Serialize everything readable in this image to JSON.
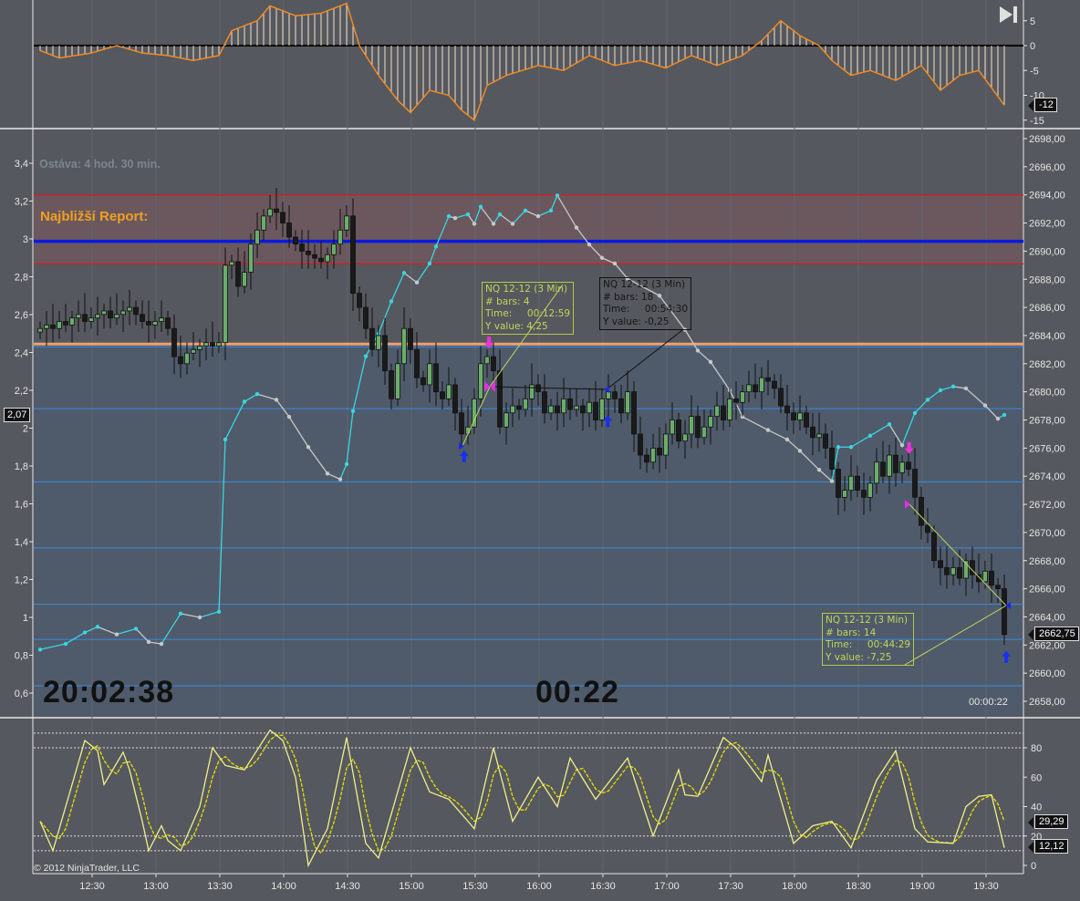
{
  "colors": {
    "bg": "#55585e",
    "up": "#6aad6a",
    "down": "#1a1a1a",
    "osc": "#f08a24",
    "cyan": "#3ad6e0",
    "gray": "#c8c8c8",
    "stochK": "#f0f08a",
    "stochD": "#e8e000",
    "red": "#c0262a",
    "blue": "#0a1ae0",
    "orange": "#f0a070",
    "hline": "#3a8ce0"
  },
  "labels": {
    "remaining": "Ostáva: 4 hod. 30 min.",
    "next_report": "Najbližší Report:",
    "clock": "20:02:38",
    "countdown": "00:22",
    "bar_timer": "00:00:22",
    "copyright": "© 2012 NinjaTrader, LLC"
  },
  "badges": {
    "osc": "-12",
    "price": "2662,75",
    "left": "2,07",
    "stoch_d": "29,29",
    "stoch_k": "12,12"
  },
  "tooltips": [
    {
      "lines": [
        "NQ 12-12 (3 Min)",
        "# bars: 4",
        "Time:     00:12:59",
        "Y value: 4,25"
      ]
    },
    {
      "lines": [
        "NQ 12-12 (3 Min)",
        "# bars: 18",
        "Time:     00:54:30",
        "Y value: -0,25"
      ]
    },
    {
      "lines": [
        "NQ 12-12 (3 Min)",
        "# bars: 14",
        "Time:     00:44:29",
        "Y value: -7,25"
      ]
    }
  ],
  "chart_data": [
    {
      "type": "bar",
      "name": "oscillator-histogram",
      "ylim": [
        -16,
        8
      ],
      "yticks": [
        "5",
        "0",
        "-5",
        "-10",
        "-15"
      ],
      "ytick_values": [
        5,
        0,
        -5,
        -10,
        -15
      ],
      "keyframes": [
        [
          0,
          -1
        ],
        [
          3,
          -2.5
        ],
        [
          8,
          -1.5
        ],
        [
          12,
          0
        ],
        [
          16,
          -1.5
        ],
        [
          20,
          -2
        ],
        [
          24,
          -3
        ],
        [
          28,
          -2
        ],
        [
          30,
          3
        ],
        [
          34,
          5
        ],
        [
          36,
          8
        ],
        [
          40,
          6
        ],
        [
          44,
          6.5
        ],
        [
          48,
          8.5
        ],
        [
          50,
          0
        ],
        [
          53,
          -6
        ],
        [
          56,
          -11
        ],
        [
          58,
          -13.5
        ],
        [
          61,
          -9
        ],
        [
          64,
          -10
        ],
        [
          66,
          -13
        ],
        [
          68,
          -15
        ],
        [
          70,
          -8
        ],
        [
          73,
          -6
        ],
        [
          78,
          -4
        ],
        [
          82,
          -5
        ],
        [
          86,
          -2
        ],
        [
          90,
          -4
        ],
        [
          94,
          -3
        ],
        [
          98,
          -4.5
        ],
        [
          102,
          -2
        ],
        [
          106,
          -4
        ],
        [
          110,
          -2
        ],
        [
          113,
          1
        ],
        [
          116,
          5
        ],
        [
          119,
          2
        ],
        [
          122,
          0
        ],
        [
          124,
          -3
        ],
        [
          127,
          -6
        ],
        [
          130,
          -5
        ],
        [
          134,
          -7
        ],
        [
          138,
          -4
        ],
        [
          141,
          -9
        ],
        [
          144,
          -6
        ],
        [
          147,
          -5
        ],
        [
          149,
          -8.5
        ],
        [
          151,
          -12
        ]
      ]
    },
    {
      "type": "candlestick",
      "name": "NQ 12-12 (3 Min)",
      "ylim": [
        2657,
        2699
      ],
      "yticks": [
        "2698,00",
        "2696,00",
        "2694,00",
        "2692,00",
        "2690,00",
        "2688,00",
        "2686,00",
        "2684,00",
        "2682,00",
        "2680,00",
        "2678,00",
        "2676,00",
        "2674,00",
        "2672,00",
        "2670,00",
        "2668,00",
        "2666,00",
        "2664,00",
        "2662,00",
        "2660,00",
        "2658,00"
      ],
      "ytick_values": [
        2698,
        2696,
        2694,
        2692,
        2690,
        2688,
        2686,
        2684,
        2682,
        2680,
        2678,
        2676,
        2674,
        2672,
        2670,
        2668,
        2666,
        2664,
        2662,
        2660,
        2658
      ],
      "closes": [
        2684.5,
        2684.75,
        2684.5,
        2685,
        2684.75,
        2685.25,
        2685.5,
        2685,
        2685.25,
        2685.5,
        2685.75,
        2685.25,
        2685.5,
        2685.75,
        2686,
        2685.5,
        2685,
        2684.75,
        2685,
        2685.25,
        2684.5,
        2682.5,
        2682,
        2682.75,
        2683,
        2683.25,
        2683.5,
        2683.25,
        2683.5,
        2689,
        2689.25,
        2687.5,
        2688.5,
        2690.5,
        2691.5,
        2692.5,
        2693,
        2692.75,
        2692,
        2691,
        2690.5,
        2690,
        2689.75,
        2689.5,
        2689.25,
        2689.75,
        2690.5,
        2691.5,
        2692.5,
        2687,
        2686,
        2684.5,
        2683,
        2684,
        2681.5,
        2679.5,
        2682,
        2684.5,
        2683,
        2681,
        2680.5,
        2682,
        2680,
        2679.5,
        2680.5,
        2678.5,
        2677,
        2677.5,
        2679.5,
        2682,
        2682.5,
        2681.5,
        2677.5,
        2678.5,
        2679,
        2678.75,
        2679.5,
        2680.5,
        2680,
        2678.5,
        2679,
        2678.5,
        2679.5,
        2678.75,
        2679,
        2678.5,
        2679.25,
        2678,
        2679.5,
        2680,
        2679.5,
        2678.5,
        2680,
        2677,
        2675.5,
        2675,
        2676,
        2675.5,
        2677,
        2678,
        2676.5,
        2677,
        2678.25,
        2676.75,
        2677.5,
        2678.25,
        2679,
        2678,
        2679.5,
        2679.25,
        2680,
        2680.5,
        2680,
        2681,
        2680.75,
        2680.25,
        2679,
        2678.5,
        2678,
        2678.5,
        2677.5,
        2676.75,
        2677,
        2676,
        2674.5,
        2672.5,
        2673,
        2674,
        2673,
        2672.5,
        2673.5,
        2675,
        2674,
        2675.5,
        2674.25,
        2675,
        2674.5,
        2672.5,
        2670.5,
        2670,
        2668,
        2667.5,
        2667,
        2667.5,
        2666.75,
        2668,
        2667,
        2666.5,
        2667.25,
        2666.25,
        2666,
        2662.75
      ],
      "levels": {
        "red_upper": 2694,
        "red_lower": 2689.1,
        "blue": 2690.7,
        "orange": 2683.4,
        "blue_thin": [
          2683.2,
          2678.8,
          2673.6,
          2668.9,
          2664.9,
          2662.4,
          2659.1
        ]
      },
      "left_axis": {
        "ylim": [
          0.5,
          3.5
        ],
        "yticks": [
          "3,4",
          "3,2",
          "3",
          "2,8",
          "2,6",
          "2,4",
          "2,2",
          "2",
          "1,8",
          "1,6",
          "1,4",
          "1,2",
          "1",
          "0,8",
          "0,6"
        ],
        "ytick_values": [
          3.4,
          3.2,
          3.0,
          2.8,
          2.6,
          2.4,
          2.2,
          2.0,
          1.8,
          1.6,
          1.4,
          1.2,
          1.0,
          0.8,
          0.6
        ]
      },
      "line_series": [
        [
          0,
          0.83
        ],
        [
          4,
          0.86
        ],
        [
          7,
          0.92
        ],
        [
          9,
          0.95
        ],
        [
          12,
          0.91
        ],
        [
          15,
          0.94
        ],
        [
          17,
          0.87
        ],
        [
          19,
          0.86
        ],
        [
          22,
          1.02
        ],
        [
          25,
          1.0
        ],
        [
          28,
          1.03
        ],
        [
          29,
          1.94
        ],
        [
          32,
          2.14
        ],
        [
          34,
          2.18
        ],
        [
          37,
          2.15
        ],
        [
          39,
          2.06
        ],
        [
          42,
          1.9
        ],
        [
          45,
          1.76
        ],
        [
          47,
          1.73
        ],
        [
          48,
          1.81
        ],
        [
          49,
          2.09
        ],
        [
          51,
          2.38
        ],
        [
          53,
          2.5
        ],
        [
          55,
          2.67
        ],
        [
          57,
          2.82
        ],
        [
          59,
          2.77
        ],
        [
          61,
          2.87
        ],
        [
          62,
          2.96
        ],
        [
          64,
          3.12
        ],
        [
          65,
          3.11
        ],
        [
          67,
          3.13
        ],
        [
          68,
          3.08
        ],
        [
          69,
          3.17
        ],
        [
          71,
          3.08
        ],
        [
          72,
          3.13
        ],
        [
          74,
          3.08
        ],
        [
          76,
          3.15
        ],
        [
          78,
          3.12
        ],
        [
          80,
          3.15
        ],
        [
          81,
          3.23
        ],
        [
          84,
          3.06
        ],
        [
          86,
          2.97
        ],
        [
          88,
          2.9
        ],
        [
          90,
          2.87
        ],
        [
          92,
          2.79
        ],
        [
          97,
          2.7
        ],
        [
          101,
          2.52
        ],
        [
          103,
          2.41
        ],
        [
          105,
          2.35
        ],
        [
          108,
          2.2
        ],
        [
          110,
          2.06
        ],
        [
          114,
          1.99
        ],
        [
          117,
          1.94
        ],
        [
          119,
          1.88
        ],
        [
          122,
          1.78
        ],
        [
          124,
          1.72
        ],
        [
          125,
          1.9
        ],
        [
          127,
          1.9
        ],
        [
          130,
          1.96
        ],
        [
          133,
          2.02
        ],
        [
          135,
          1.91
        ],
        [
          137,
          2.08
        ],
        [
          139,
          2.15
        ],
        [
          141,
          2.2
        ],
        [
          143,
          2.22
        ],
        [
          145,
          2.21
        ],
        [
          148,
          2.12
        ],
        [
          150,
          2.05
        ],
        [
          151,
          2.07
        ]
      ]
    },
    {
      "type": "line",
      "name": "stochastics",
      "ylim": [
        -5,
        100
      ],
      "yticks": [
        "80",
        "60",
        "40",
        "20",
        "0"
      ],
      "ytick_values": [
        80,
        60,
        40,
        20,
        0
      ],
      "dashed_levels": [
        90,
        80,
        20,
        10
      ],
      "d_smoothing": 3,
      "k_series": [
        [
          0,
          30
        ],
        [
          2,
          10
        ],
        [
          6,
          70
        ],
        [
          7,
          85
        ],
        [
          9,
          78
        ],
        [
          10,
          55
        ],
        [
          13,
          77
        ],
        [
          14,
          65
        ],
        [
          16,
          30
        ],
        [
          17,
          10
        ],
        [
          19,
          27
        ],
        [
          20,
          17
        ],
        [
          22,
          10
        ],
        [
          25,
          40
        ],
        [
          27,
          80
        ],
        [
          29,
          68
        ],
        [
          32,
          65
        ],
        [
          36,
          92
        ],
        [
          38,
          85
        ],
        [
          40,
          60
        ],
        [
          42,
          0
        ],
        [
          45,
          25
        ],
        [
          48,
          87
        ],
        [
          51,
          15
        ],
        [
          53,
          5
        ],
        [
          58,
          80
        ],
        [
          61,
          50
        ],
        [
          64,
          45
        ],
        [
          68,
          25
        ],
        [
          71,
          80
        ],
        [
          74,
          30
        ],
        [
          78,
          60
        ],
        [
          81,
          40
        ],
        [
          83,
          73
        ],
        [
          87,
          45
        ],
        [
          92,
          73
        ],
        [
          96,
          20
        ],
        [
          100,
          65
        ],
        [
          101,
          48
        ],
        [
          103,
          47
        ],
        [
          107,
          87
        ],
        [
          109,
          80
        ],
        [
          113,
          57
        ],
        [
          114,
          75
        ],
        [
          118,
          15
        ],
        [
          121,
          27
        ],
        [
          124,
          30
        ],
        [
          127,
          12
        ],
        [
          131,
          58
        ],
        [
          134,
          78
        ],
        [
          137,
          25
        ],
        [
          139,
          16
        ],
        [
          143,
          15
        ],
        [
          145,
          40
        ],
        [
          147,
          47
        ],
        [
          149,
          48
        ],
        [
          151,
          12
        ]
      ]
    }
  ],
  "x_axis": {
    "ticks": [
      "12:30",
      "13:00",
      "13:30",
      "14:00",
      "14:30",
      "15:00",
      "15:30",
      "16:00",
      "16:30",
      "17:00",
      "17:30",
      "18:00",
      "18:30",
      "19:00",
      "19:30"
    ],
    "first_tick_bar": 8.14,
    "bars_per_tick": 10
  },
  "markers": {
    "up_arrows_bars": [
      66.4,
      88.9,
      151.3
    ],
    "down_arrows_bars": [
      70.3,
      136.1
    ]
  }
}
